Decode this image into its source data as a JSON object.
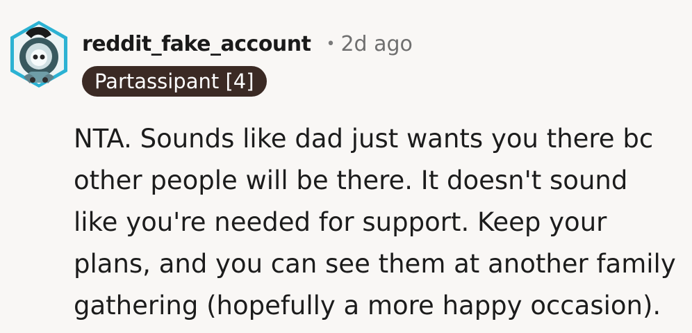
{
  "comment": {
    "author": "reddit_fake_account",
    "separator": "•",
    "timestamp": "2d ago",
    "flair": "Partassipant [4]",
    "avatar_icon": "snoo-avatar-icon",
    "body": "NTA. Sounds like dad just wants you there bc other people will be there. It doesn't sound like you're needed for support. Keep your plans, and you can see them at another family gathering (hopefully a more happy occasion)."
  },
  "colors": {
    "background": "#f9f7f5",
    "flair_background": "#3b2a24",
    "avatar_frame": "#1fa3c4"
  }
}
